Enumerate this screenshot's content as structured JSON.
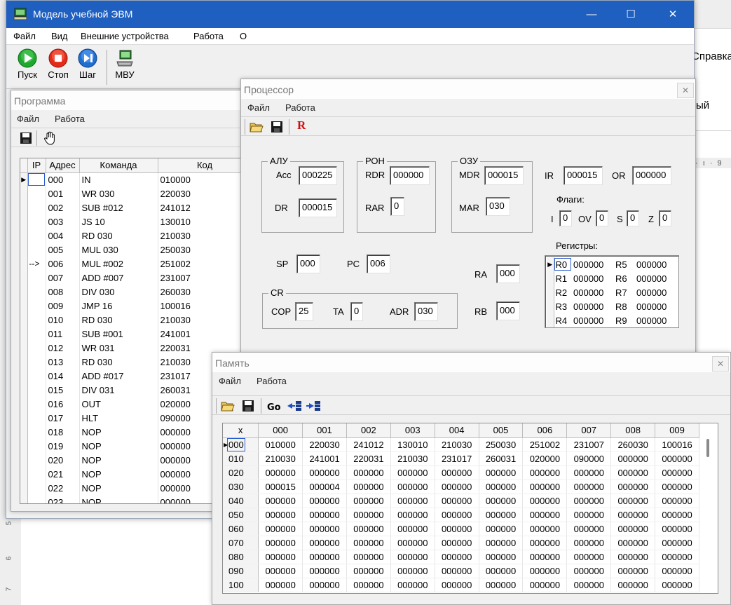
{
  "background": {
    "help_menu": "Справка",
    "partial_word": "ый",
    "ruler_text": "· ı · 9",
    "vertical_ruler": [
      "5",
      "6",
      "7"
    ]
  },
  "main": {
    "title": "Модель учебной ЭВМ",
    "window_buttons": {
      "minimize": "—",
      "maximize": "☐",
      "close": "✕"
    },
    "menu": [
      "Файл",
      "Вид",
      "Внешние устройства",
      "Работа",
      "О"
    ],
    "toolbar": {
      "start": "Пуск",
      "stop": "Стоп",
      "step": "Шаг",
      "mvu": "МВУ"
    },
    "colors": {
      "titlebar": "#1f5fbf",
      "start": "#1fa82d",
      "stop": "#e32b1a",
      "step": "#1f6fd0"
    }
  },
  "program": {
    "title": "Программа",
    "menu": [
      "Файл",
      "Работа"
    ],
    "columns": [
      "IP",
      "Адрес",
      "Команда",
      "Код"
    ],
    "rows": [
      {
        "ip": "",
        "addr": "000",
        "cmd": "IN",
        "code": "010000"
      },
      {
        "ip": "",
        "addr": "001",
        "cmd": "WR 030",
        "code": "220030"
      },
      {
        "ip": "",
        "addr": "002",
        "cmd": "SUB #012",
        "code": "241012"
      },
      {
        "ip": "",
        "addr": "003",
        "cmd": "JS 10",
        "code": "130010"
      },
      {
        "ip": "",
        "addr": "004",
        "cmd": "RD 030",
        "code": "210030"
      },
      {
        "ip": "",
        "addr": "005",
        "cmd": "MUL 030",
        "code": "250030"
      },
      {
        "ip": "-->",
        "addr": "006",
        "cmd": "MUL #002",
        "code": "251002"
      },
      {
        "ip": "",
        "addr": "007",
        "cmd": "ADD #007",
        "code": "231007"
      },
      {
        "ip": "",
        "addr": "008",
        "cmd": "DIV 030",
        "code": "260030"
      },
      {
        "ip": "",
        "addr": "009",
        "cmd": "JMP 16",
        "code": "100016"
      },
      {
        "ip": "",
        "addr": "010",
        "cmd": "RD 030",
        "code": "210030"
      },
      {
        "ip": "",
        "addr": "011",
        "cmd": "SUB #001",
        "code": "241001"
      },
      {
        "ip": "",
        "addr": "012",
        "cmd": "WR 031",
        "code": "220031"
      },
      {
        "ip": "",
        "addr": "013",
        "cmd": "RD 030",
        "code": "210030"
      },
      {
        "ip": "",
        "addr": "014",
        "cmd": "ADD #017",
        "code": "231017"
      },
      {
        "ip": "",
        "addr": "015",
        "cmd": "DIV 031",
        "code": "260031"
      },
      {
        "ip": "",
        "addr": "016",
        "cmd": "OUT",
        "code": "020000"
      },
      {
        "ip": "",
        "addr": "017",
        "cmd": "HLT",
        "code": "090000"
      },
      {
        "ip": "",
        "addr": "018",
        "cmd": "NOP",
        "code": "000000"
      },
      {
        "ip": "",
        "addr": "019",
        "cmd": "NOP",
        "code": "000000"
      },
      {
        "ip": "",
        "addr": "020",
        "cmd": "NOP",
        "code": "000000"
      },
      {
        "ip": "",
        "addr": "021",
        "cmd": "NOP",
        "code": "000000"
      },
      {
        "ip": "",
        "addr": "022",
        "cmd": "NOP",
        "code": "000000"
      },
      {
        "ip": "",
        "addr": "023",
        "cmd": "NOP",
        "code": "000000"
      }
    ]
  },
  "processor": {
    "title": "Процессор",
    "menu": [
      "Файл",
      "Работа"
    ],
    "reset_label": "R",
    "alu": {
      "label": "АЛУ",
      "acc_label": "Acc",
      "acc": "000225",
      "dr_label": "DR",
      "dr": "000015"
    },
    "ron": {
      "label": "РОН",
      "rdr_label": "RDR",
      "rdr": "000000",
      "rar_label": "RAR",
      "rar": "0"
    },
    "ozu": {
      "label": "ОЗУ",
      "mdr_label": "MDR",
      "mdr": "000015",
      "mar_label": "MAR",
      "mar": "030"
    },
    "ir_label": "IR",
    "ir": "000015",
    "or_label": "OR",
    "or": "000000",
    "flags": {
      "label": "Флаги:",
      "items": [
        {
          "name": "I",
          "value": "0"
        },
        {
          "name": "OV",
          "value": "0"
        },
        {
          "name": "S",
          "value": "0"
        },
        {
          "name": "Z",
          "value": "0"
        }
      ]
    },
    "sp_label": "SP",
    "sp": "000",
    "pc_label": "PC",
    "pc": "006",
    "ra_label": "RA",
    "ra": "000",
    "rb_label": "RB",
    "rb": "000",
    "cr": {
      "label": "CR",
      "cop_label": "COP",
      "cop": "25",
      "ta_label": "TA",
      "ta": "0",
      "adr_label": "ADR",
      "adr": "030"
    },
    "registers": {
      "label": "Регистры:",
      "rows": [
        {
          "n1": "R0",
          "v1": "000000",
          "n2": "R5",
          "v2": "000000"
        },
        {
          "n1": "R1",
          "v1": "000000",
          "n2": "R6",
          "v2": "000000"
        },
        {
          "n1": "R2",
          "v1": "000000",
          "n2": "R7",
          "v2": "000000"
        },
        {
          "n1": "R3",
          "v1": "000000",
          "n2": "R8",
          "v2": "000000"
        },
        {
          "n1": "R4",
          "v1": "000000",
          "n2": "R9",
          "v2": "000000"
        }
      ]
    }
  },
  "memory": {
    "title": "Память",
    "menu": [
      "Файл",
      "Работа"
    ],
    "columns": [
      "x",
      "000",
      "001",
      "002",
      "003",
      "004",
      "005",
      "006",
      "007",
      "008",
      "009"
    ],
    "rows": [
      {
        "addr": "000",
        "cells": [
          "010000",
          "220030",
          "241012",
          "130010",
          "210030",
          "250030",
          "251002",
          "231007",
          "260030",
          "100016"
        ]
      },
      {
        "addr": "010",
        "cells": [
          "210030",
          "241001",
          "220031",
          "210030",
          "231017",
          "260031",
          "020000",
          "090000",
          "000000",
          "000000"
        ]
      },
      {
        "addr": "020",
        "cells": [
          "000000",
          "000000",
          "000000",
          "000000",
          "000000",
          "000000",
          "000000",
          "000000",
          "000000",
          "000000"
        ]
      },
      {
        "addr": "030",
        "cells": [
          "000015",
          "000004",
          "000000",
          "000000",
          "000000",
          "000000",
          "000000",
          "000000",
          "000000",
          "000000"
        ]
      },
      {
        "addr": "040",
        "cells": [
          "000000",
          "000000",
          "000000",
          "000000",
          "000000",
          "000000",
          "000000",
          "000000",
          "000000",
          "000000"
        ]
      },
      {
        "addr": "050",
        "cells": [
          "000000",
          "000000",
          "000000",
          "000000",
          "000000",
          "000000",
          "000000",
          "000000",
          "000000",
          "000000"
        ]
      },
      {
        "addr": "060",
        "cells": [
          "000000",
          "000000",
          "000000",
          "000000",
          "000000",
          "000000",
          "000000",
          "000000",
          "000000",
          "000000"
        ]
      },
      {
        "addr": "070",
        "cells": [
          "000000",
          "000000",
          "000000",
          "000000",
          "000000",
          "000000",
          "000000",
          "000000",
          "000000",
          "000000"
        ]
      },
      {
        "addr": "080",
        "cells": [
          "000000",
          "000000",
          "000000",
          "000000",
          "000000",
          "000000",
          "000000",
          "000000",
          "000000",
          "000000"
        ]
      },
      {
        "addr": "090",
        "cells": [
          "000000",
          "000000",
          "000000",
          "000000",
          "000000",
          "000000",
          "000000",
          "000000",
          "000000",
          "000000"
        ]
      },
      {
        "addr": "100",
        "cells": [
          "000000",
          "000000",
          "000000",
          "000000",
          "000000",
          "000000",
          "000000",
          "000000",
          "000000",
          "000000"
        ]
      }
    ]
  }
}
